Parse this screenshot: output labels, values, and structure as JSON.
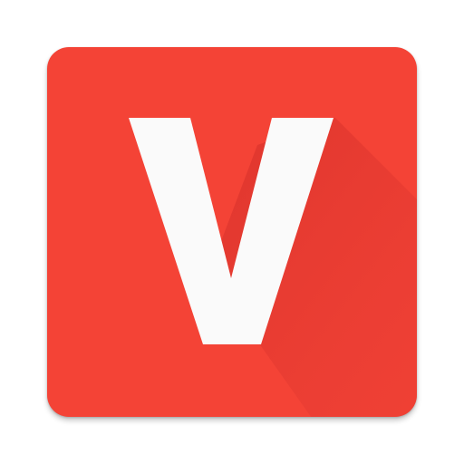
{
  "app_icon": {
    "letter": "V",
    "colors": {
      "background": "#f44336",
      "long_shadow": "#c62828",
      "glyph": "#fafafa"
    }
  }
}
